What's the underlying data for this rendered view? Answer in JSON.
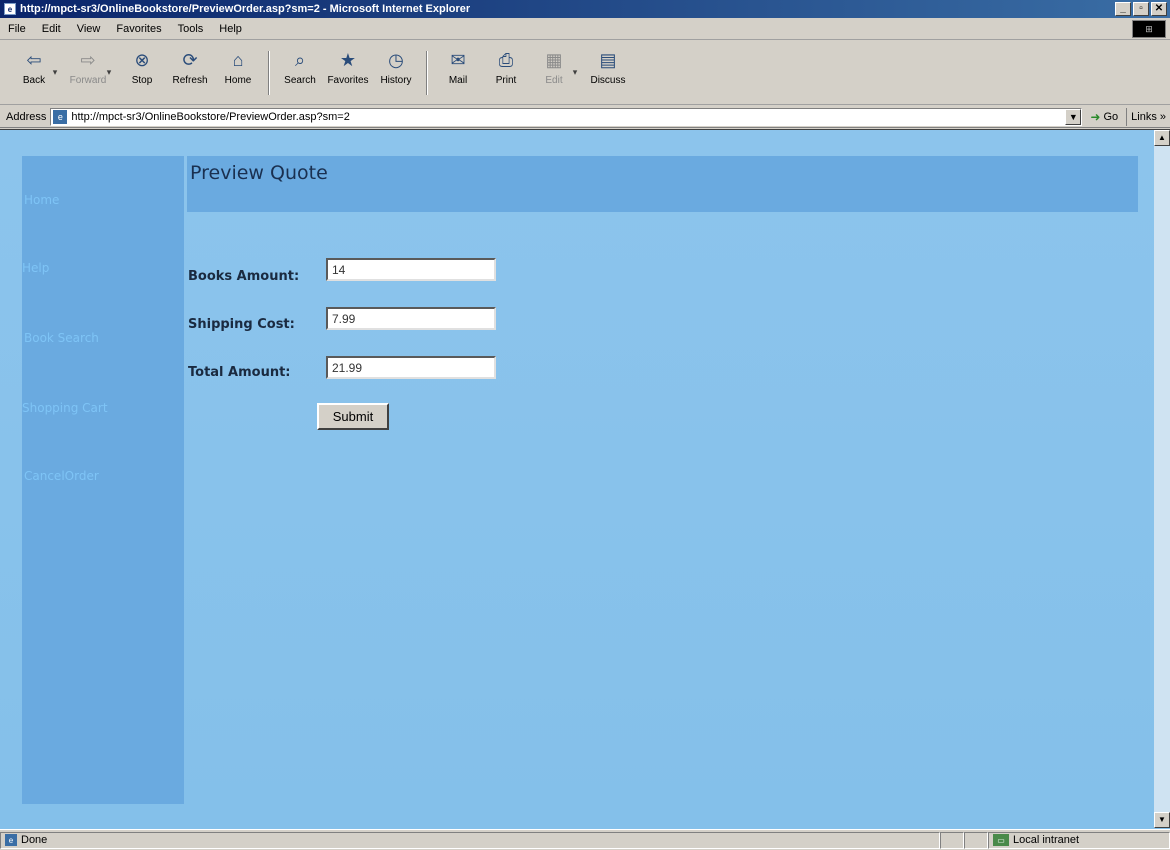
{
  "window": {
    "title": "http://mpct-sr3/OnlineBookstore/PreviewOrder.asp?sm=2 - Microsoft Internet Explorer",
    "minimize": "_",
    "maximize": "▫",
    "close": "✕"
  },
  "menu": [
    "File",
    "Edit",
    "View",
    "Favorites",
    "Tools",
    "Help"
  ],
  "toolbar": {
    "back": "Back",
    "forward": "Forward",
    "stop": "Stop",
    "refresh": "Refresh",
    "home": "Home",
    "search": "Search",
    "favorites": "Favorites",
    "history": "History",
    "mail": "Mail",
    "print": "Print",
    "edit": "Edit",
    "discuss": "Discuss"
  },
  "address": {
    "label": "Address",
    "url": "http://mpct-sr3/OnlineBookstore/PreviewOrder.asp?sm=2",
    "go": "Go",
    "links": "Links »"
  },
  "sidebar": {
    "items": [
      {
        "label": "Home"
      },
      {
        "label": "Help"
      },
      {
        "label": "Book Search"
      },
      {
        "label": "Shopping Cart"
      },
      {
        "label": "CancelOrder"
      }
    ]
  },
  "page": {
    "title": "Preview Quote"
  },
  "form": {
    "books_amount_label": "Books Amount:",
    "books_amount_value": "14",
    "shipping_cost_label": "Shipping Cost:",
    "shipping_cost_value": "7.99",
    "total_amount_label": "Total Amount:",
    "total_amount_value": "21.99",
    "submit_label": "Submit"
  },
  "status": {
    "text": "Done",
    "zone": "Local intranet"
  }
}
